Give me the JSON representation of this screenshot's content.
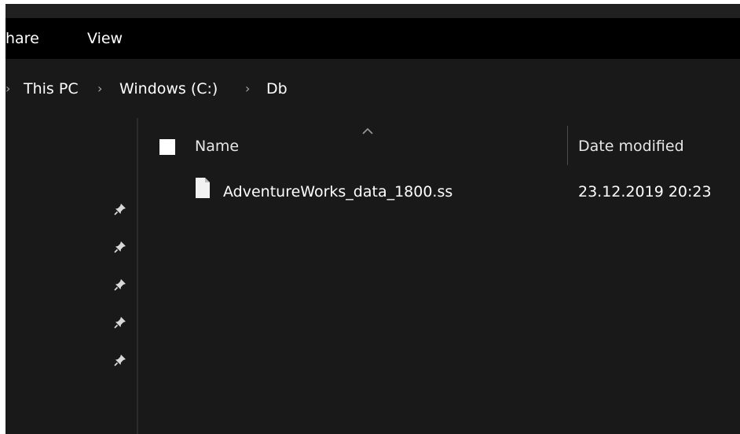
{
  "ribbon": {
    "tabs": [
      {
        "label": "hare"
      },
      {
        "label": "View"
      }
    ]
  },
  "address": {
    "separator": "›",
    "crumbs": [
      {
        "label": "This PC"
      },
      {
        "label": "Windows (C:)"
      },
      {
        "label": "Db"
      }
    ]
  },
  "nav_pane": {
    "pinned_count": 5
  },
  "list": {
    "columns": [
      {
        "label": "Name"
      },
      {
        "label": "Date modified"
      }
    ],
    "sort_indicator": "chevron-up-icon",
    "files": [
      {
        "name": "AdventureWorks_data_1800.ss",
        "date_modified": "23.12.2019 20:23",
        "icon": "file-icon"
      }
    ]
  },
  "colors": {
    "background": "#191919",
    "ribbon": "#000000",
    "text": "#ffffff",
    "secondary_text": "#a8a8a8"
  }
}
